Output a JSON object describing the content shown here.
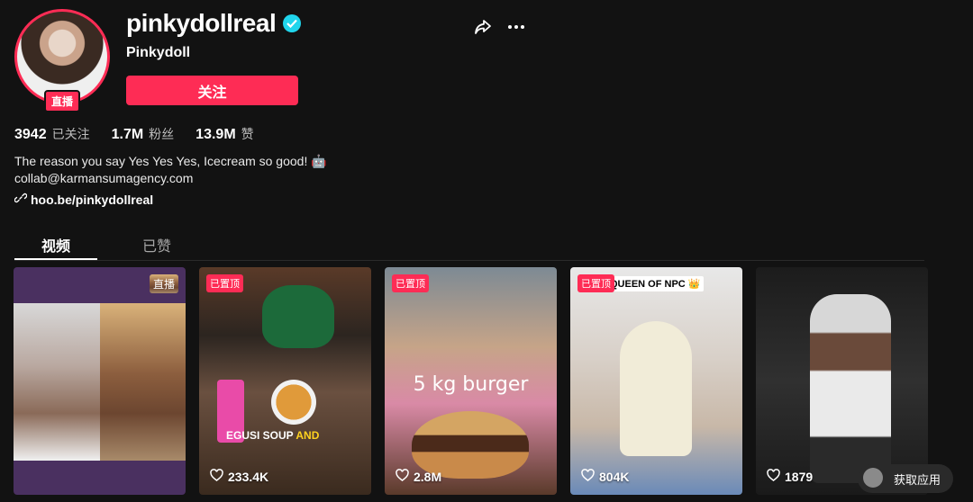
{
  "profile": {
    "username": "pinkydollreal",
    "nickname": "Pinkydoll",
    "live_badge": "直播",
    "follow_label": "关注"
  },
  "stats": [
    {
      "value": "3942",
      "label": "已关注"
    },
    {
      "value": "1.7M",
      "label": "粉丝"
    },
    {
      "value": "13.9M",
      "label": "赞"
    }
  ],
  "bio": {
    "line1": "The reason you say Yes Yes Yes, Icecream so good! 🤖",
    "line2": "collab@karmansumagency.com",
    "link": "hoo.be/pinkydollreal"
  },
  "tabs": [
    {
      "label": "视频",
      "active": true
    },
    {
      "label": "已赞",
      "active": false
    }
  ],
  "videos": [
    {
      "tag": "直播",
      "likes": ""
    },
    {
      "tag": "已置顶",
      "likes": "233.4K",
      "caption_white": "EGUSI SOUP",
      "caption_yellow": " AND"
    },
    {
      "tag": "已置顶",
      "likes": "2.8M",
      "caption": "5 kg burger"
    },
    {
      "tag": "已置顶",
      "likes": "804K",
      "banner": "QUEEN OF NPC 👑"
    },
    {
      "tag": "",
      "likes": "1879"
    }
  ],
  "get_app": "获取应用",
  "colors": {
    "accent": "#fe2c55",
    "background": "#121212",
    "verified": "#20d5ec"
  }
}
